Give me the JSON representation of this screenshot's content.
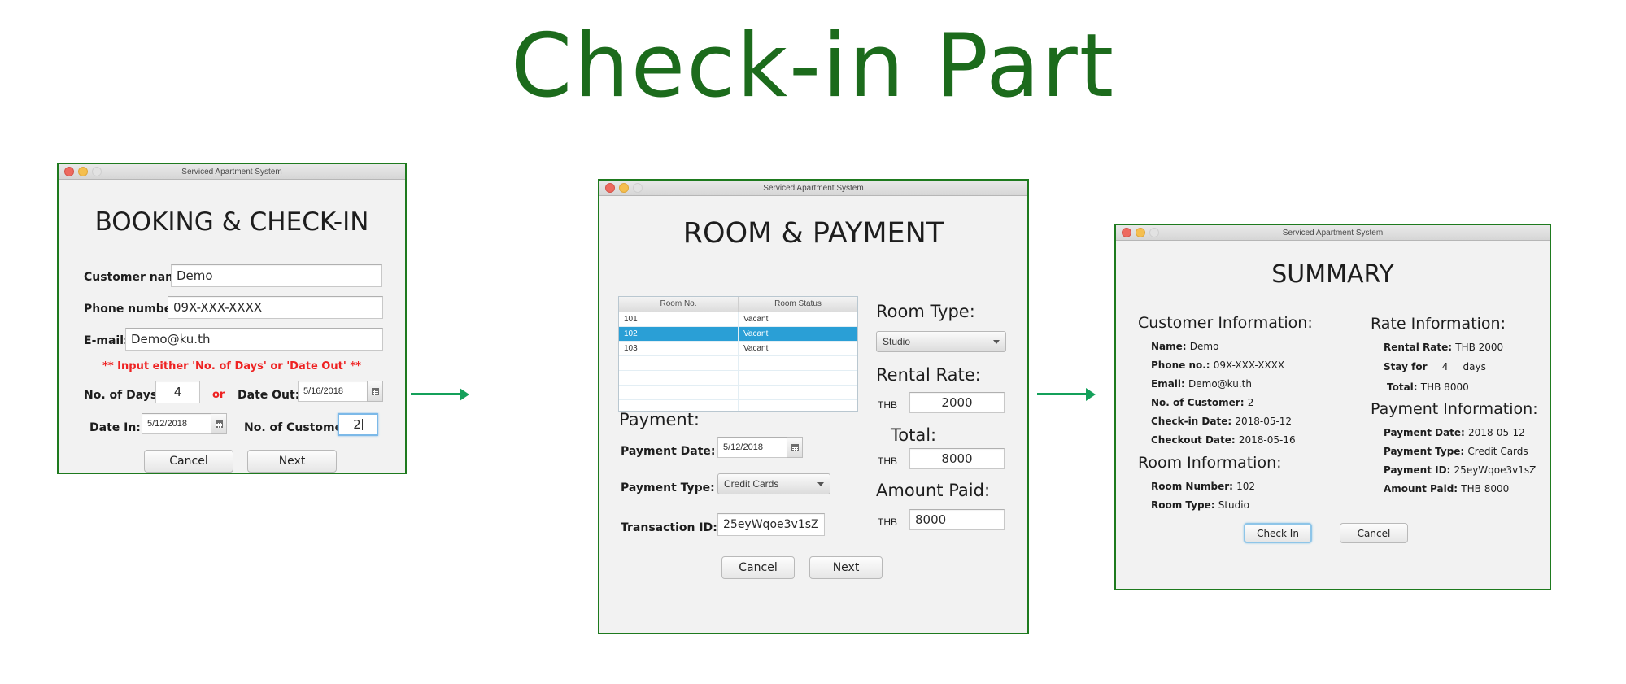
{
  "page": {
    "title": "Check-in Part",
    "accent_green": "#1e7a1e",
    "arrow_green": "#14a05a",
    "selection_blue": "#2a9fd6",
    "warning_red": "#ee2222"
  },
  "window1": {
    "titlebar": "Serviced Apartment System",
    "heading": "BOOKING & CHECK-IN",
    "labels": {
      "customer_name": "Customer name:",
      "phone_number": "Phone number:",
      "email": "E-mail:",
      "no_of_days": "No. of Days:",
      "or": "or",
      "date_out": "Date Out:",
      "date_in": "Date In:",
      "no_of_customer": "No. of Customer:"
    },
    "values": {
      "customer_name": "Demo",
      "phone_number": "09X-XXX-XXXX",
      "email": "Demo@ku.th",
      "no_of_days": "4",
      "date_out": "5/16/2018",
      "date_in": "5/12/2018",
      "no_of_customer": "2"
    },
    "warning": "** Input either 'No. of Days' or 'Date Out' **",
    "buttons": {
      "cancel": "Cancel",
      "next": "Next"
    }
  },
  "window2": {
    "titlebar": "Serviced Apartment System",
    "heading": "ROOM & PAYMENT",
    "table": {
      "columns": [
        "Room No.",
        "Room Status"
      ],
      "rows": [
        {
          "room_no": "101",
          "status": "Vacant",
          "selected": false
        },
        {
          "room_no": "102",
          "status": "Vacant",
          "selected": true
        },
        {
          "room_no": "103",
          "status": "Vacant",
          "selected": false
        }
      ],
      "empty_rows": 4
    },
    "room_type": {
      "label": "Room Type:",
      "value": "Studio"
    },
    "rental_rate": {
      "label": "Rental Rate:",
      "currency": "THB",
      "value": "2000"
    },
    "total": {
      "label": "Total:",
      "currency": "THB",
      "value": "8000"
    },
    "amount_paid": {
      "label": "Amount Paid:",
      "currency": "THB",
      "value": "8000"
    },
    "payment": {
      "heading": "Payment:",
      "date_label": "Payment Date:",
      "date_value": "5/12/2018",
      "type_label": "Payment Type:",
      "type_value": "Credit Cards",
      "txn_label": "Transaction ID:",
      "txn_value": "25eyWqoe3v1sZ"
    },
    "buttons": {
      "cancel": "Cancel",
      "next": "Next"
    }
  },
  "window3": {
    "titlebar": "Serviced Apartment System",
    "heading": "SUMMARY",
    "customer_information": {
      "heading": "Customer Information:",
      "items": [
        {
          "label": "Name:",
          "value": "Demo"
        },
        {
          "label": "Phone no.:",
          "value": "09X-XXX-XXXX"
        },
        {
          "label": "Email:",
          "value": "Demo@ku.th"
        },
        {
          "label": "No. of Customer:",
          "value": "2"
        },
        {
          "label": "Check-in Date:",
          "value": "2018-05-12"
        },
        {
          "label": "Checkout Date:",
          "value": "2018-05-16"
        }
      ]
    },
    "room_information": {
      "heading": "Room Information:",
      "items": [
        {
          "label": "Room Number:",
          "value": "102"
        },
        {
          "label": "Room Type:",
          "value": "Studio"
        }
      ]
    },
    "rate_information": {
      "heading": "Rate Information:",
      "items": [
        {
          "label": "Rental Rate:",
          "value": "THB 2000"
        },
        {
          "label": "Stay for",
          "value": "4",
          "suffix": "days"
        },
        {
          "label": "Total:",
          "value": "THB  8000"
        }
      ]
    },
    "payment_information": {
      "heading": "Payment Information:",
      "items": [
        {
          "label": "Payment Date:",
          "value": "2018-05-12"
        },
        {
          "label": "Payment Type:",
          "value": "Credit Cards"
        },
        {
          "label": "Payment ID:",
          "value": "25eyWqoe3v1sZ"
        },
        {
          "label": "Amount Paid:",
          "value": "THB 8000"
        }
      ]
    },
    "buttons": {
      "check_in": "Check In",
      "cancel": "Cancel"
    }
  }
}
